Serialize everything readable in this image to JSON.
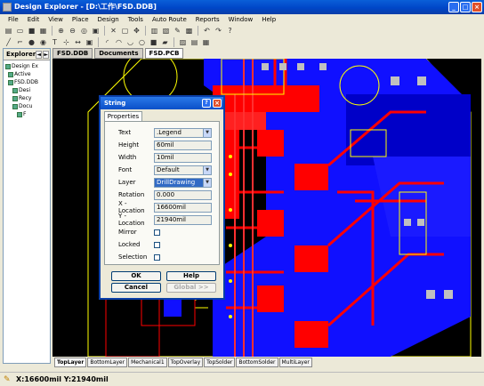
{
  "window": {
    "title": "Design Explorer - [D:\\工作\\FSD.DDB]",
    "minimize": "_",
    "maximize": "□",
    "close": "×"
  },
  "menu": [
    "File",
    "Edit",
    "View",
    "Place",
    "Design",
    "Tools",
    "Auto Route",
    "Reports",
    "Window",
    "Help"
  ],
  "left_panel": {
    "title": "Explorer",
    "tree": [
      "Design Ex",
      "Active",
      "FSD.DDB",
      "Desi",
      "Recy",
      "Docu",
      "F"
    ]
  },
  "doc_tabs": [
    "FSD.DDB",
    "Documents",
    "FSD.PCB"
  ],
  "dialog": {
    "title": "String",
    "tab": "Properties",
    "fields": [
      {
        "label": "Text",
        "value": ".Legend",
        "type": "dropdown"
      },
      {
        "label": "Height",
        "value": "60mil",
        "type": "input"
      },
      {
        "label": "Width",
        "value": "10mil",
        "type": "input"
      },
      {
        "label": "Font",
        "value": "Default",
        "type": "dropdown"
      },
      {
        "label": "Layer",
        "value": "DrillDrawing",
        "type": "dropdown"
      },
      {
        "label": "Rotation",
        "value": "0.000",
        "type": "input"
      },
      {
        "label": "X - Location",
        "value": "16600mil",
        "type": "input"
      },
      {
        "label": "Y - Location",
        "value": "21940mil",
        "type": "input"
      }
    ],
    "checks": [
      "Mirror",
      "Locked",
      "Selection"
    ],
    "ok": "OK",
    "help": "Help",
    "cancel": "Cancel",
    "global": "Global >>"
  },
  "layer_tabs": [
    "TopLayer",
    "BottomLayer",
    "Mechanical1",
    "TopOverlay",
    "TopSolder",
    "BottomSolder",
    "MultiLayer"
  ],
  "status": {
    "coords": "X:16600mil Y:21940mil"
  },
  "colors": {
    "pcb_bg": "#000000",
    "top_copper": "#ff0000",
    "bottom_copper": "#0000ff",
    "overlay": "#ffff00",
    "pads": "#c0c0c0"
  }
}
